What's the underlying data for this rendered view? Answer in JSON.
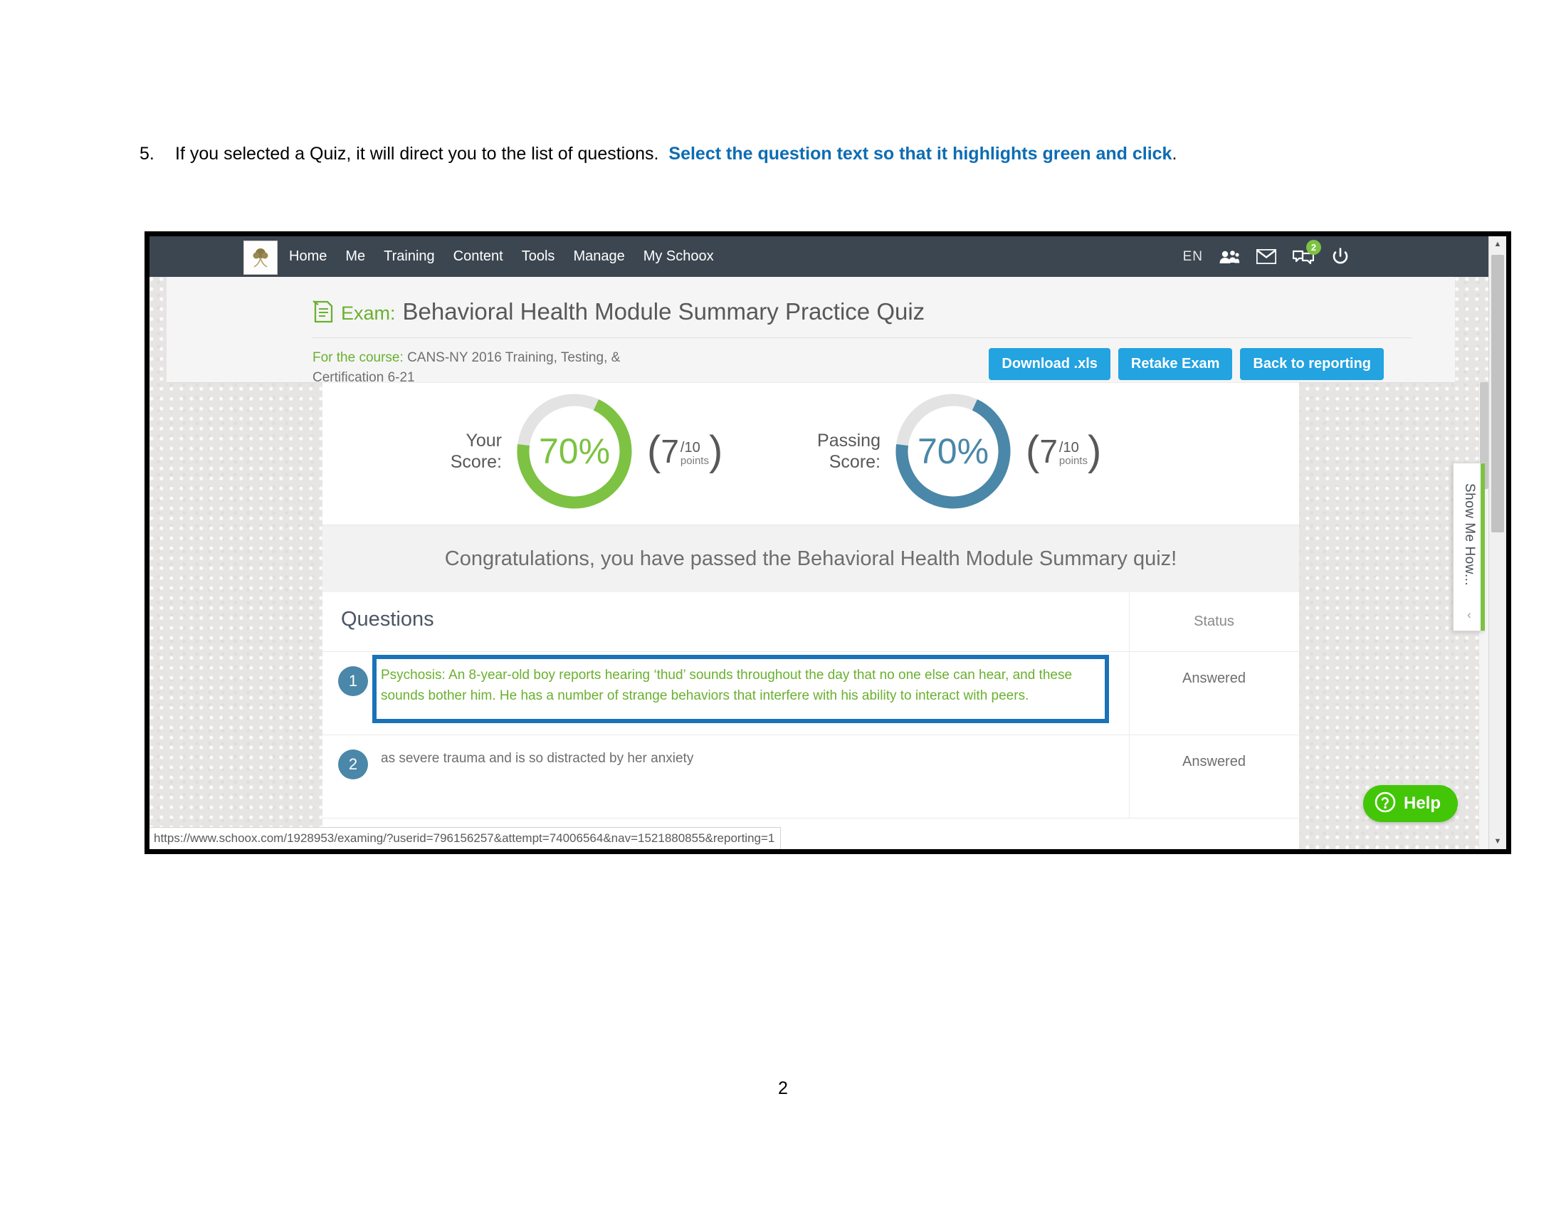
{
  "document": {
    "instruction_number": "5.",
    "instruction_text": "If you selected a Quiz, it will direct you to the list of questions.",
    "instruction_emphasis": "Select the question text so that it highlights green and click",
    "instruction_period": ".",
    "page_number": "2",
    "accent_blue": "#0d6cb3"
  },
  "navbar": {
    "logo_icon": "tree-logo-icon",
    "links": [
      "Home",
      "Me",
      "Training",
      "Content",
      "Tools",
      "Manage",
      "My Schoox"
    ],
    "language": "EN",
    "icons": [
      "people-icon",
      "envelope-icon",
      "chat-bubbles-icon",
      "power-icon"
    ],
    "chat_badge_count": "2",
    "badge_color": "#7dc242",
    "background": "#3c4650"
  },
  "exam_header": {
    "icon": "exam-clipboard-icon",
    "label": "Exam:",
    "title": "Behavioral Health Module Summary Practice Quiz",
    "course_label": "For the course:",
    "course_name": "CANS-NY 2016 Training, Testing, & Certification 6-21",
    "buttons": [
      "Download .xls",
      "Retake Exam",
      "Back to reporting"
    ],
    "button_color": "#23a3e0",
    "green": "#6ab02f"
  },
  "scores": {
    "your": {
      "label_line1": "Your",
      "label_line2": "Score:",
      "percent": "70%",
      "percent_value": 70,
      "points": "7",
      "denominator": "/10",
      "points_word": "points",
      "color": "#7dc242"
    },
    "passing": {
      "label_line1": "Passing",
      "label_line2": "Score:",
      "percent": "70%",
      "percent_value": 70,
      "points": "7",
      "denominator": "/10",
      "points_word": "points",
      "color": "#4a87a8"
    }
  },
  "banner": {
    "message": "Congratulations, you have passed the Behavioral Health Module Summary quiz!"
  },
  "questions_table": {
    "header_questions": "Questions",
    "header_status": "Status",
    "rows": [
      {
        "number": "1",
        "text": "Psychosis: An 8-year-old boy reports hearing ‘thud’ sounds throughout the day that no one else can hear, and these sounds bother him. He has a number of strange behaviors that interfere with his ability to interact with peers.",
        "status": "Answered",
        "selected": true
      },
      {
        "number": "2",
        "text": "as severe trauma and is so distracted by her anxiety",
        "status": "Answered",
        "selected": false
      }
    ],
    "annotation_color": "#1a72b8"
  },
  "side_tab": {
    "label": "Show Me How...",
    "chevron": "‹",
    "accent_color": "#7dc242"
  },
  "help_widget": {
    "label": "Help",
    "icon": "question-mark-icon",
    "color": "#43c608"
  },
  "status_bar": {
    "url": "https://www.schoox.com/1928953/examing/?userid=796156257&attempt=74006564&nav=1521880855&reporting=1"
  }
}
